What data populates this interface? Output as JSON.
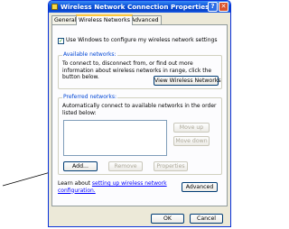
{
  "window": {
    "title": "Wireless Network Connection Properties",
    "help_label": "?",
    "close_label": "✕"
  },
  "tabs": [
    "General",
    "Wireless Networks",
    "Advanced"
  ],
  "settings": {
    "use_windows_label": "Use Windows to configure my wireless network settings",
    "use_windows_checked": true
  },
  "available": {
    "group_label": "Available networks:",
    "description": "To connect to, disconnect from, or find out more information about wireless networks in range, click the button below.",
    "view_button": "View Wireless Networks"
  },
  "preferred": {
    "group_label": "Preferred networks:",
    "description": "Automatically connect to available networks in the order listed below:",
    "move_up": "Move up",
    "move_down": "Move down",
    "add": "Add...",
    "remove": "Remove",
    "properties": "Properties"
  },
  "learn": {
    "prefix": "Learn about ",
    "link": "setting up wireless network configuration.",
    "advanced_button": "Advanced"
  },
  "footer": {
    "ok": "OK",
    "cancel": "Cancel"
  },
  "colors": {
    "titlebar": "#0a4fd6",
    "group_label": "#0046d5",
    "link": "#0000ff"
  }
}
